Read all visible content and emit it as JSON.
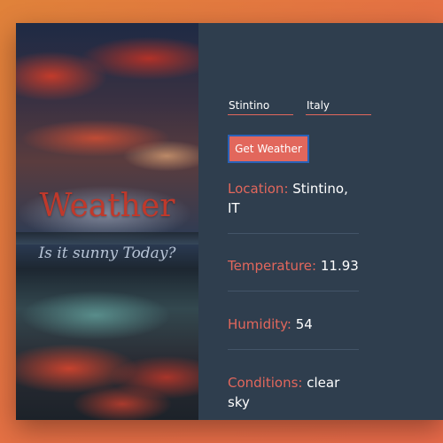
{
  "hero": {
    "title": "Weather",
    "subtitle": "Is it sunny Today?"
  },
  "form": {
    "city_value": "Stintino",
    "country_value": "Italy",
    "button_label": "Get Weather"
  },
  "results": {
    "location_label": "Location:",
    "location_value": "Stintino, IT",
    "temperature_label": "Temperature:",
    "temperature_value": "11.93",
    "humidity_label": "Humidity:",
    "humidity_value": "54",
    "conditions_label": "Conditions:",
    "conditions_value": "clear sky"
  },
  "colors": {
    "accent": "#e2675c",
    "panel": "#2f3e4e",
    "button_border": "#2a62b8"
  }
}
